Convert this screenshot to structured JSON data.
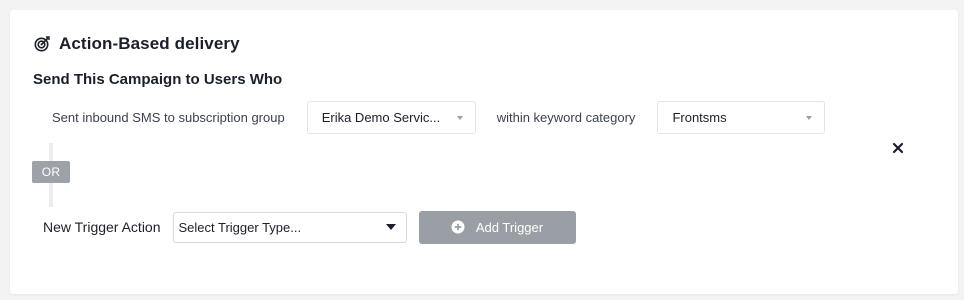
{
  "section": {
    "title": "Action-Based delivery",
    "icon": "target-icon",
    "subtitle": "Send This Campaign to Users Who"
  },
  "rule": {
    "prefix_text": "Sent inbound SMS to subscription group",
    "group_value": "Erika Demo Servic...",
    "within_text": "within keyword category",
    "keyword_value": "Frontsms",
    "remove_icon": "close-icon"
  },
  "or_badge": "OR",
  "new_trigger": {
    "label": "New Trigger Action",
    "select_value": "Select Trigger Type...",
    "add_button_label": "Add Trigger",
    "add_icon": "plus-circle-icon"
  },
  "colors": {
    "text_dark": "#1b1f2a",
    "disabled_button": "#9a9ea5",
    "or_badge": "#9da1a8"
  }
}
